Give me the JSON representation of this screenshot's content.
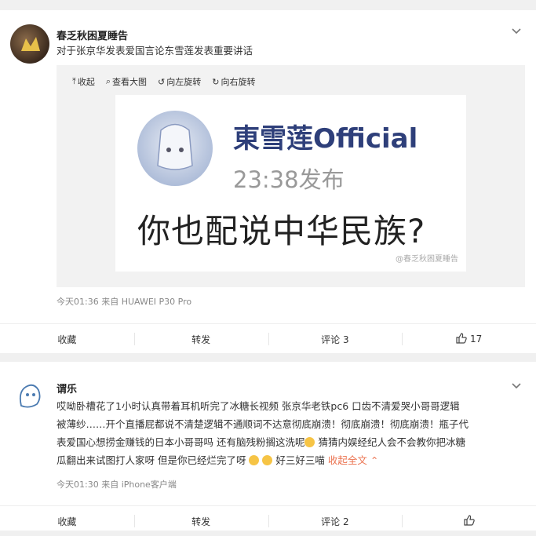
{
  "post1": {
    "username": "春乏秋困夏睡告",
    "text": "对于张京华发表爱国言论东雪莲发表重要讲话",
    "toolbar": {
      "collapse": "收起",
      "view_large": "查看大图",
      "rotate_left": "向左旋转",
      "rotate_right": "向右旋转"
    },
    "image": {
      "name": "東雪莲Official",
      "time": "23:38发布",
      "quote": "你也配说中华民族?",
      "watermark": "@春乏秋困夏睡告"
    },
    "meta": "今天01:36  来自 HUAWEI P30 Pro",
    "actions": {
      "favorite": "收藏",
      "repost": "转发",
      "comment": "评论 3",
      "like": "17"
    }
  },
  "post2": {
    "username": "谓乐",
    "line1": "哎呦卧槽花了1小时认真带着耳机听完了冰糖长视频 张京华老铁pc6 口齿不清爱哭小哥哥逻辑",
    "line2": "被薄纱……开个直播屁都说不清楚逻辑不通顺词不达意彻底崩溃！彻底崩溃！彻底崩溃！瓶子代",
    "line3": "表爱国心想捞金赚钱的日本小哥哥吗 还有脑残粉搁这洗呢",
    "line3b": " 猜猜内娱经纪人会不会教你把冰糖",
    "line4": "瓜翻出来试图打人家呀 但是你已经烂完了呀",
    "line4b": " 好三好三喵 ",
    "expand": "收起全文",
    "meta": "今天01:30  来自 iPhone客户端",
    "actions": {
      "favorite": "收藏",
      "repost": "转发",
      "comment": "评论 2"
    }
  }
}
